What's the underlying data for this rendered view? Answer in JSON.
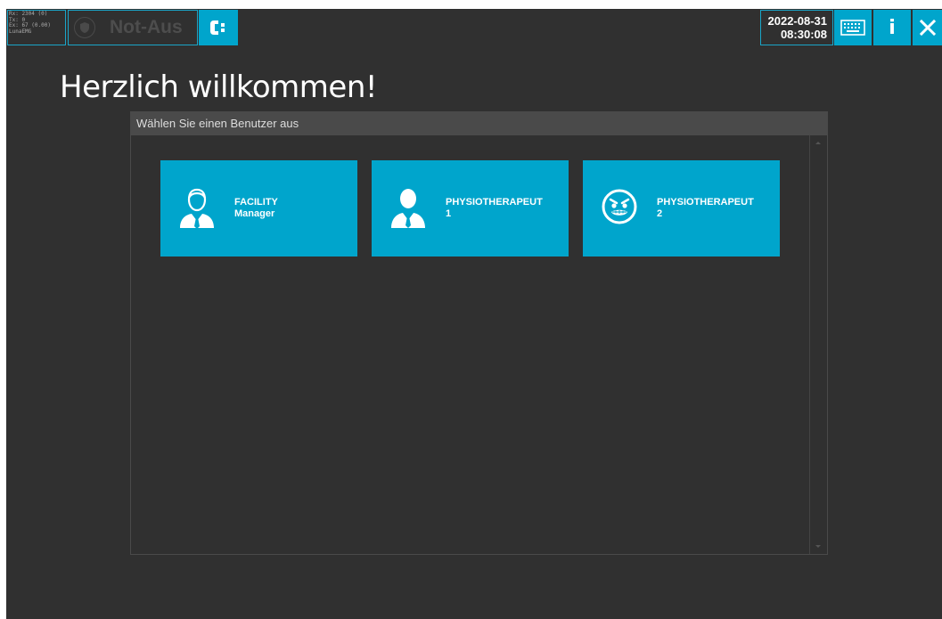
{
  "debug": {
    "lines": [
      "Rx: 2304 (0)",
      "Tx: 0",
      "Ex: 67 (0.00)",
      "LunaEMG"
    ]
  },
  "emergency": {
    "label": "Not-Aus"
  },
  "datetime": {
    "date": "2022-08-31",
    "time": "08:30:08"
  },
  "toolbar": {
    "info_label": "i",
    "icons": [
      "connection-icon",
      "keyboard-icon",
      "info-icon",
      "close-icon"
    ]
  },
  "main": {
    "title": "Herzlich willkommen!",
    "panel_title": "Wählen Sie einen Benutzer aus",
    "users": [
      {
        "line1": "FACILITY",
        "line2": "Manager",
        "icon": "manager-avatar-icon"
      },
      {
        "line1": "PHYSIOTHERAPEUT",
        "line2": "1",
        "icon": "user-avatar-icon"
      },
      {
        "line1": "PHYSIOTHERAPEUT",
        "line2": "2",
        "icon": "angry-face-icon"
      }
    ]
  },
  "colors": {
    "accent": "#00a5cc",
    "background": "#303030",
    "panel_header": "#4a4a4a"
  }
}
